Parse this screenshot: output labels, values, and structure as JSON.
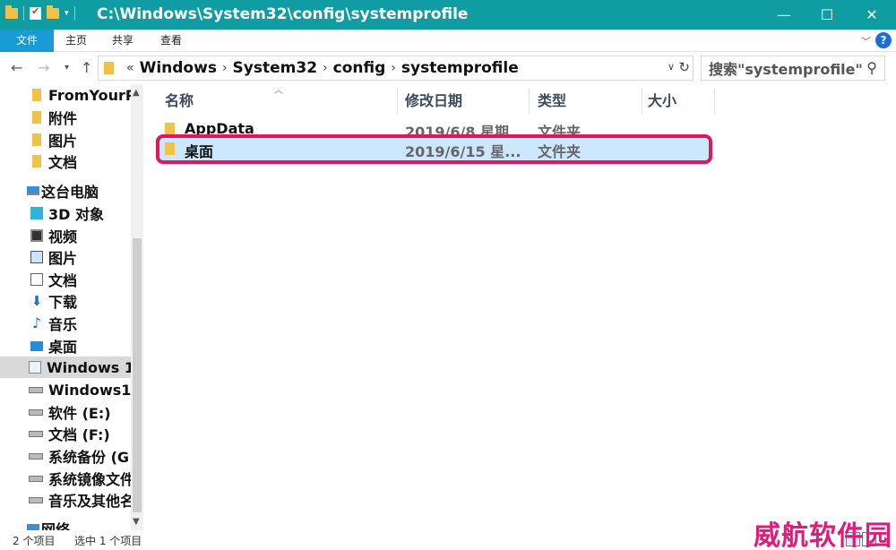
{
  "window": {
    "title": "C:\\Windows\\System32\\config\\systemprofile",
    "minimize": "—",
    "maximize": "☐",
    "close": "✕"
  },
  "ribbon": {
    "tabs": [
      "文件",
      "主页",
      "共享",
      "查看"
    ],
    "help": "?"
  },
  "address": {
    "prefix": "«",
    "crumbs": [
      "Windows",
      "System32",
      "config",
      "systemprofile"
    ],
    "separator": "›"
  },
  "search": {
    "placeholder": "搜索\"systemprofile\""
  },
  "sidebar": {
    "items": [
      {
        "label": "FromYourP",
        "icon": "folder-icon"
      },
      {
        "label": "附件",
        "icon": "folder-icon"
      },
      {
        "label": "图片",
        "icon": "folder-icon"
      },
      {
        "label": "文档",
        "icon": "folder-icon"
      },
      {
        "label": "这台电脑",
        "icon": "computer-icon"
      },
      {
        "label": "3D 对象",
        "icon": "3d-objects-icon"
      },
      {
        "label": "视频",
        "icon": "video-icon"
      },
      {
        "label": "图片",
        "icon": "pictures-icon"
      },
      {
        "label": "文档",
        "icon": "documents-icon"
      },
      {
        "label": "下载",
        "icon": "download-icon"
      },
      {
        "label": "音乐",
        "icon": "music-icon"
      },
      {
        "label": "桌面",
        "icon": "desktop-icon"
      },
      {
        "label": "Windows 1",
        "icon": "windows-drive-icon"
      },
      {
        "label": "Windows1(",
        "icon": "drive-icon"
      },
      {
        "label": "软件 (E:)",
        "icon": "drive-icon"
      },
      {
        "label": "文档 (F:)",
        "icon": "drive-icon"
      },
      {
        "label": "系统备份 (G",
        "icon": "drive-icon"
      },
      {
        "label": "系统镜像文件",
        "icon": "drive-icon"
      },
      {
        "label": "音乐及其他名",
        "icon": "drive-icon"
      },
      {
        "label": "网络",
        "icon": "network-icon"
      }
    ]
  },
  "columns": {
    "name": "名称",
    "date": "修改日期",
    "type": "类型",
    "size": "大小"
  },
  "files": [
    {
      "name": "AppData",
      "date": "2019/6/8 星期...",
      "type": "文件夹"
    },
    {
      "name": "桌面",
      "date": "2019/6/15 星...",
      "type": "文件夹"
    }
  ],
  "status": {
    "count": "2 个项目",
    "selected": "选中 1 个项目"
  },
  "watermark": "威航软件园"
}
